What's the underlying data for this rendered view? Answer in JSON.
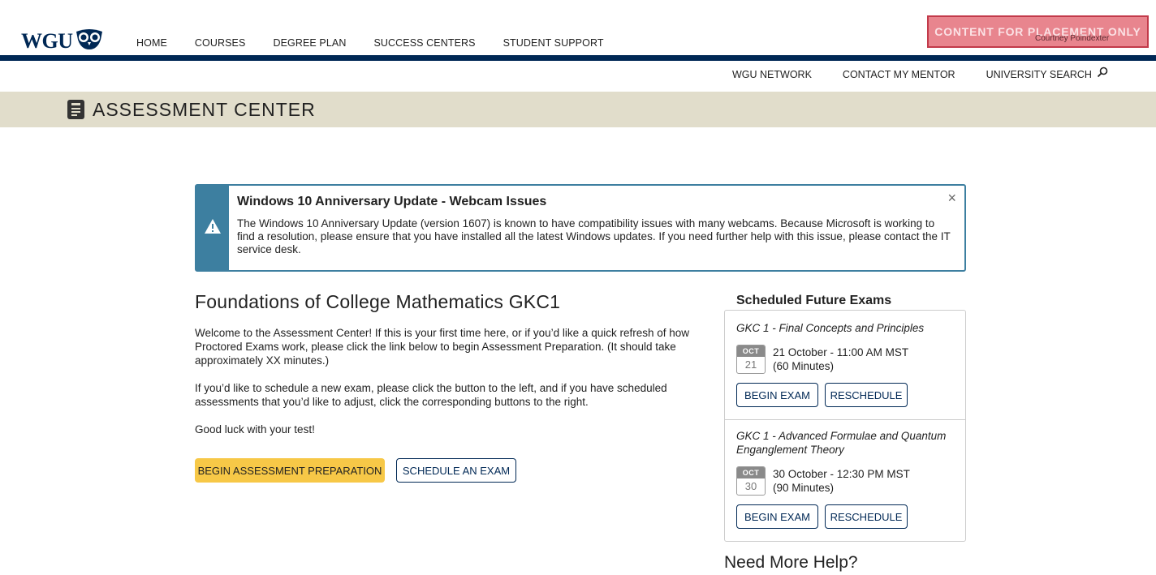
{
  "header": {
    "logo_text": "WGU",
    "nav": [
      "HOME",
      "COURSES",
      "DEGREE PLAN",
      "SUCCESS CENTERS",
      "STUDENT SUPPORT"
    ],
    "placement_banner": "CONTENT FOR PLACEMENT ONLY",
    "username": "Courtney Poindexter",
    "brand_color": "#002855"
  },
  "subnav": {
    "items": [
      "WGU NETWORK",
      "CONTACT MY MENTOR",
      "UNIVERSITY SEARCH"
    ],
    "search_icon": "search-icon"
  },
  "section": {
    "title": "ASSESSMENT CENTER",
    "icon": "assessment-icon",
    "band_color": "#e1ddcb"
  },
  "alert": {
    "title": "Windows 10 Anniversary Update - Webcam Issues",
    "body": "The Windows 10 Anniversary Update (version 1607) is known to have compatibility issues with many webcams. Because Microsoft is working to find a resolution, please ensure that you have installed all the latest Windows updates. If you need further help with this issue, please contact the IT service desk.",
    "close": "×",
    "icon": "warning-icon",
    "color": "#3d7fa0"
  },
  "main": {
    "course_title": "Foundations of College Mathematics GKC1",
    "paragraphs": [
      "Welcome to the Assessment Center! If this is your first time here, or if you’d like a quick refresh of how Proctored Exams work, please click the link below to begin Assessment Preparation. (It should take approximately XX minutes.)",
      "If you’d like to schedule a new exam, please click the button to the left, and if you have scheduled assessments that you’d like to adjust, click the corresponding buttons to the right.",
      "Good luck with your test!"
    ],
    "begin_prep_label": "BEGIN ASSESSMENT PREPARATION",
    "schedule_label": "SCHEDULE AN EXAM",
    "accent_yellow": "#f7c847"
  },
  "scheduled": {
    "heading": "Scheduled Future Exams",
    "exams": [
      {
        "name": "GKC 1 - Final Concepts and Principles",
        "month": "OCT",
        "day": "21",
        "date_time": "21 October - 11:00 AM MST",
        "duration": "(60 Minutes)",
        "begin_label": "BEGIN EXAM",
        "reschedule_label": "RESCHEDULE"
      },
      {
        "name": "GKC 1 - Advanced Formulae and Quantum Enganglement Theory",
        "month": "OCT",
        "day": "30",
        "date_time": "30 October - 12:30 PM MST",
        "duration": "(90 Minutes)",
        "begin_label": "BEGIN EXAM",
        "reschedule_label": "RESCHEDULE"
      }
    ]
  },
  "help": {
    "title": "Need More Help?"
  }
}
